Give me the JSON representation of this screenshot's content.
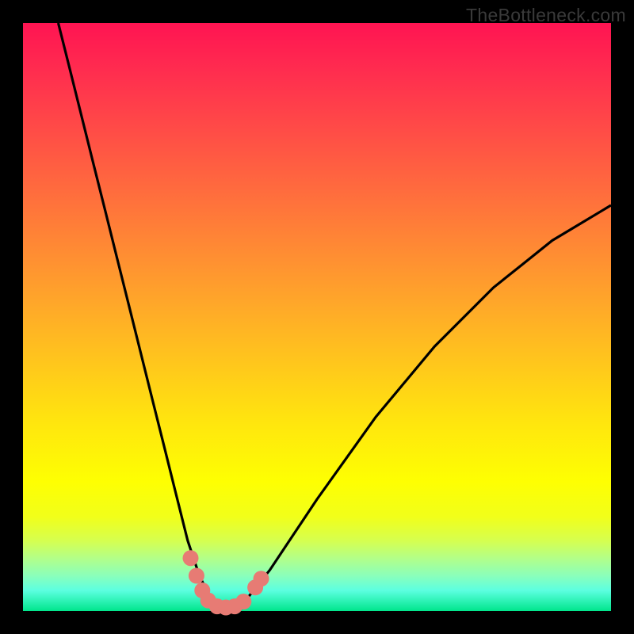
{
  "watermark": "TheBottleneck.com",
  "chart_data": {
    "type": "line",
    "title": "",
    "xlabel": "",
    "ylabel": "",
    "xlim": [
      0,
      100
    ],
    "ylim": [
      0,
      100
    ],
    "series": [
      {
        "name": "bottleneck-curve",
        "x": [
          6,
          8,
          10,
          12,
          14,
          16,
          18,
          20,
          22,
          24,
          26,
          28,
          30,
          32,
          34,
          36,
          38,
          42,
          46,
          50,
          55,
          60,
          65,
          70,
          75,
          80,
          85,
          90,
          95,
          100
        ],
        "y": [
          100,
          92,
          84,
          76,
          68,
          60,
          52,
          44,
          36,
          28,
          20,
          12,
          6,
          2,
          0,
          0,
          2,
          7,
          13,
          19,
          26,
          33,
          39,
          45,
          50,
          55,
          59,
          63,
          66,
          69
        ]
      }
    ],
    "markers": {
      "name": "highlighted-points",
      "color": "#e77b74",
      "points": [
        {
          "x": 28.5,
          "y": 9
        },
        {
          "x": 29.5,
          "y": 6
        },
        {
          "x": 30.5,
          "y": 3.5
        },
        {
          "x": 31.5,
          "y": 1.8
        },
        {
          "x": 33,
          "y": 0.8
        },
        {
          "x": 34.5,
          "y": 0.6
        },
        {
          "x": 36,
          "y": 0.8
        },
        {
          "x": 37.5,
          "y": 1.6
        },
        {
          "x": 39.5,
          "y": 4
        },
        {
          "x": 40.5,
          "y": 5.5
        }
      ]
    },
    "gradient_stops": [
      {
        "pos": 0,
        "color": "#ff1452"
      },
      {
        "pos": 50,
        "color": "#ffb020"
      },
      {
        "pos": 80,
        "color": "#ffff00"
      },
      {
        "pos": 100,
        "color": "#00e68c"
      }
    ]
  }
}
